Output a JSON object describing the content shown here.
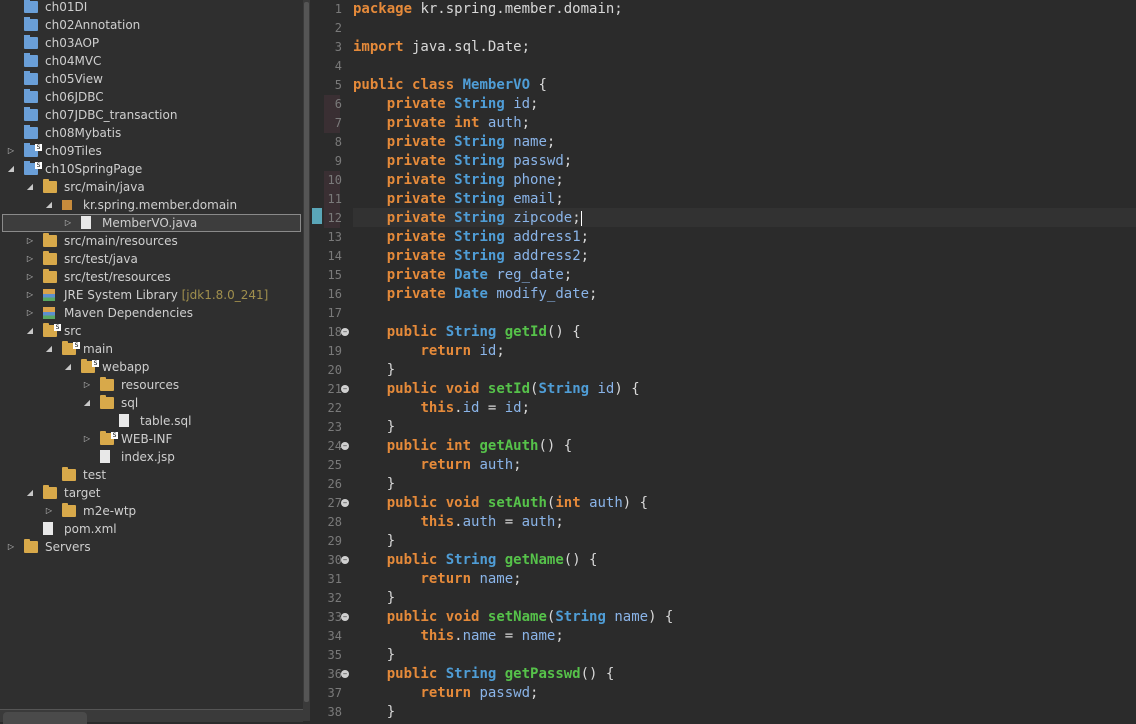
{
  "explorer": {
    "items": [
      {
        "label": "ch01DI",
        "indent": 0,
        "icon": "project-folder-icon",
        "arrow": ""
      },
      {
        "label": "ch02Annotation",
        "indent": 0,
        "icon": "project-folder-icon",
        "arrow": ""
      },
      {
        "label": "ch03AOP",
        "indent": 0,
        "icon": "project-folder-icon",
        "arrow": ""
      },
      {
        "label": "ch04MVC",
        "indent": 0,
        "icon": "project-folder-icon",
        "arrow": ""
      },
      {
        "label": "ch05View",
        "indent": 0,
        "icon": "project-folder-icon",
        "arrow": ""
      },
      {
        "label": "ch06JDBC",
        "indent": 0,
        "icon": "project-folder-icon",
        "arrow": ""
      },
      {
        "label": "ch07JDBC_transaction",
        "indent": 0,
        "icon": "project-folder-icon",
        "arrow": ""
      },
      {
        "label": "ch08Mybatis",
        "indent": 0,
        "icon": "project-folder-icon",
        "arrow": ""
      },
      {
        "label": "ch09Tiles",
        "indent": 0,
        "icon": "maven-project-icon",
        "arrow": "collapsed"
      },
      {
        "label": "ch10SpringPage",
        "indent": 0,
        "icon": "maven-project-icon",
        "arrow": "expanded"
      },
      {
        "label": "src/main/java",
        "indent": 1,
        "icon": "source-folder-icon",
        "arrow": "expanded"
      },
      {
        "label": "kr.spring.member.domain",
        "indent": 2,
        "icon": "package-icon",
        "arrow": "expanded"
      },
      {
        "label": "MemberVO.java",
        "indent": 3,
        "icon": "java-file-icon",
        "arrow": "collapsed",
        "selected": true
      },
      {
        "label": "src/main/resources",
        "indent": 1,
        "icon": "source-folder-icon",
        "arrow": "collapsed"
      },
      {
        "label": "src/test/java",
        "indent": 1,
        "icon": "source-folder-icon",
        "arrow": "collapsed"
      },
      {
        "label": "src/test/resources",
        "indent": 1,
        "icon": "source-folder-icon",
        "arrow": "collapsed"
      },
      {
        "label": "JRE System Library",
        "suffix": "[jdk1.8.0_241]",
        "indent": 1,
        "icon": "library-icon",
        "arrow": "collapsed"
      },
      {
        "label": "Maven Dependencies",
        "indent": 1,
        "icon": "library-icon",
        "arrow": "collapsed"
      },
      {
        "label": "src",
        "indent": 1,
        "icon": "folder-icon",
        "arrow": "expanded"
      },
      {
        "label": "main",
        "indent": 2,
        "icon": "folder-icon",
        "arrow": "expanded"
      },
      {
        "label": "webapp",
        "indent": 3,
        "icon": "folder-icon",
        "arrow": "expanded"
      },
      {
        "label": "resources",
        "indent": 4,
        "icon": "folder-icon",
        "arrow": "collapsed"
      },
      {
        "label": "sql",
        "indent": 4,
        "icon": "folder-icon",
        "arrow": "expanded"
      },
      {
        "label": "table.sql",
        "indent": 5,
        "icon": "sql-file-icon",
        "arrow": ""
      },
      {
        "label": "WEB-INF",
        "indent": 4,
        "icon": "folder-icon",
        "arrow": "collapsed"
      },
      {
        "label": "index.jsp",
        "indent": 4,
        "icon": "jsp-file-icon",
        "arrow": ""
      },
      {
        "label": "test",
        "indent": 2,
        "icon": "folder-icon",
        "arrow": ""
      },
      {
        "label": "target",
        "indent": 1,
        "icon": "folder-icon",
        "arrow": "expanded"
      },
      {
        "label": "m2e-wtp",
        "indent": 2,
        "icon": "folder-icon",
        "arrow": "collapsed"
      },
      {
        "label": "pom.xml",
        "indent": 1,
        "icon": "maven-pom-icon",
        "arrow": ""
      },
      {
        "label": "Servers",
        "indent": 0,
        "icon": "folder-icon",
        "arrow": "collapsed"
      }
    ]
  },
  "editor": {
    "lines": [
      [
        [
          "kw",
          "package"
        ],
        [
          "p",
          " kr.spring.member.domain;"
        ]
      ],
      [],
      [
        [
          "kw",
          "import"
        ],
        [
          "p",
          " java.sql.Date;"
        ]
      ],
      [],
      [
        [
          "kw",
          "public"
        ],
        [
          "p",
          " "
        ],
        [
          "kw",
          "class"
        ],
        [
          "p",
          " "
        ],
        [
          "ty",
          "MemberVO"
        ],
        [
          "p",
          " {"
        ]
      ],
      [
        [
          "p",
          "    "
        ],
        [
          "kw",
          "private"
        ],
        [
          "p",
          " "
        ],
        [
          "ty",
          "String"
        ],
        [
          "p",
          " "
        ],
        [
          "fd",
          "id"
        ],
        [
          "p",
          ";"
        ]
      ],
      [
        [
          "p",
          "    "
        ],
        [
          "kw",
          "private"
        ],
        [
          "p",
          " "
        ],
        [
          "kw",
          "int"
        ],
        [
          "p",
          " "
        ],
        [
          "fd",
          "auth"
        ],
        [
          "p",
          ";"
        ]
      ],
      [
        [
          "p",
          "    "
        ],
        [
          "kw",
          "private"
        ],
        [
          "p",
          " "
        ],
        [
          "ty",
          "String"
        ],
        [
          "p",
          " "
        ],
        [
          "fd",
          "name"
        ],
        [
          "p",
          ";"
        ]
      ],
      [
        [
          "p",
          "    "
        ],
        [
          "kw",
          "private"
        ],
        [
          "p",
          " "
        ],
        [
          "ty",
          "String"
        ],
        [
          "p",
          " "
        ],
        [
          "fd",
          "passwd"
        ],
        [
          "p",
          ";"
        ]
      ],
      [
        [
          "p",
          "    "
        ],
        [
          "kw",
          "private"
        ],
        [
          "p",
          " "
        ],
        [
          "ty",
          "String"
        ],
        [
          "p",
          " "
        ],
        [
          "fd",
          "phone"
        ],
        [
          "p",
          ";"
        ]
      ],
      [
        [
          "p",
          "    "
        ],
        [
          "kw",
          "private"
        ],
        [
          "p",
          " "
        ],
        [
          "ty",
          "String"
        ],
        [
          "p",
          " "
        ],
        [
          "fd",
          "email"
        ],
        [
          "p",
          ";"
        ]
      ],
      [
        [
          "p",
          "    "
        ],
        [
          "kw",
          "private"
        ],
        [
          "p",
          " "
        ],
        [
          "ty",
          "String"
        ],
        [
          "p",
          " "
        ],
        [
          "fd",
          "zipcode"
        ],
        [
          "p",
          ";"
        ],
        [
          "cursor",
          ""
        ]
      ],
      [
        [
          "p",
          "    "
        ],
        [
          "kw",
          "private"
        ],
        [
          "p",
          " "
        ],
        [
          "ty",
          "String"
        ],
        [
          "p",
          " "
        ],
        [
          "fd",
          "address1"
        ],
        [
          "p",
          ";"
        ]
      ],
      [
        [
          "p",
          "    "
        ],
        [
          "kw",
          "private"
        ],
        [
          "p",
          " "
        ],
        [
          "ty",
          "String"
        ],
        [
          "p",
          " "
        ],
        [
          "fd",
          "address2"
        ],
        [
          "p",
          ";"
        ]
      ],
      [
        [
          "p",
          "    "
        ],
        [
          "kw",
          "private"
        ],
        [
          "p",
          " "
        ],
        [
          "ty",
          "Date"
        ],
        [
          "p",
          " "
        ],
        [
          "fd",
          "reg_date"
        ],
        [
          "p",
          ";"
        ]
      ],
      [
        [
          "p",
          "    "
        ],
        [
          "kw",
          "private"
        ],
        [
          "p",
          " "
        ],
        [
          "ty",
          "Date"
        ],
        [
          "p",
          " "
        ],
        [
          "fd",
          "modify_date"
        ],
        [
          "p",
          ";"
        ]
      ],
      [],
      [
        [
          "p",
          "    "
        ],
        [
          "kw",
          "public"
        ],
        [
          "p",
          " "
        ],
        [
          "ty",
          "String"
        ],
        [
          "p",
          " "
        ],
        [
          "mt",
          "getId"
        ],
        [
          "p",
          "() {"
        ]
      ],
      [
        [
          "p",
          "        "
        ],
        [
          "kw",
          "return"
        ],
        [
          "p",
          " "
        ],
        [
          "fd",
          "id"
        ],
        [
          "p",
          ";"
        ]
      ],
      [
        [
          "p",
          "    }"
        ]
      ],
      [
        [
          "p",
          "    "
        ],
        [
          "kw",
          "public"
        ],
        [
          "p",
          " "
        ],
        [
          "kw",
          "void"
        ],
        [
          "p",
          " "
        ],
        [
          "mt",
          "setId"
        ],
        [
          "p",
          "("
        ],
        [
          "ty",
          "String"
        ],
        [
          "p",
          " "
        ],
        [
          "fd",
          "id"
        ],
        [
          "p",
          ") {"
        ]
      ],
      [
        [
          "p",
          "        "
        ],
        [
          "kw",
          "this"
        ],
        [
          "p",
          "."
        ],
        [
          "fd",
          "id"
        ],
        [
          "p",
          " = "
        ],
        [
          "fd",
          "id"
        ],
        [
          "p",
          ";"
        ]
      ],
      [
        [
          "p",
          "    }"
        ]
      ],
      [
        [
          "p",
          "    "
        ],
        [
          "kw",
          "public"
        ],
        [
          "p",
          " "
        ],
        [
          "kw",
          "int"
        ],
        [
          "p",
          " "
        ],
        [
          "mt",
          "getAuth"
        ],
        [
          "p",
          "() {"
        ]
      ],
      [
        [
          "p",
          "        "
        ],
        [
          "kw",
          "return"
        ],
        [
          "p",
          " "
        ],
        [
          "fd",
          "auth"
        ],
        [
          "p",
          ";"
        ]
      ],
      [
        [
          "p",
          "    }"
        ]
      ],
      [
        [
          "p",
          "    "
        ],
        [
          "kw",
          "public"
        ],
        [
          "p",
          " "
        ],
        [
          "kw",
          "void"
        ],
        [
          "p",
          " "
        ],
        [
          "mt",
          "setAuth"
        ],
        [
          "p",
          "("
        ],
        [
          "kw",
          "int"
        ],
        [
          "p",
          " "
        ],
        [
          "fd",
          "auth"
        ],
        [
          "p",
          ") {"
        ]
      ],
      [
        [
          "p",
          "        "
        ],
        [
          "kw",
          "this"
        ],
        [
          "p",
          "."
        ],
        [
          "fd",
          "auth"
        ],
        [
          "p",
          " = "
        ],
        [
          "fd",
          "auth"
        ],
        [
          "p",
          ";"
        ]
      ],
      [
        [
          "p",
          "    }"
        ]
      ],
      [
        [
          "p",
          "    "
        ],
        [
          "kw",
          "public"
        ],
        [
          "p",
          " "
        ],
        [
          "ty",
          "String"
        ],
        [
          "p",
          " "
        ],
        [
          "mt",
          "getName"
        ],
        [
          "p",
          "() {"
        ]
      ],
      [
        [
          "p",
          "        "
        ],
        [
          "kw",
          "return"
        ],
        [
          "p",
          " "
        ],
        [
          "fd",
          "name"
        ],
        [
          "p",
          ";"
        ]
      ],
      [
        [
          "p",
          "    }"
        ]
      ],
      [
        [
          "p",
          "    "
        ],
        [
          "kw",
          "public"
        ],
        [
          "p",
          " "
        ],
        [
          "kw",
          "void"
        ],
        [
          "p",
          " "
        ],
        [
          "mt",
          "setName"
        ],
        [
          "p",
          "("
        ],
        [
          "ty",
          "String"
        ],
        [
          "p",
          " "
        ],
        [
          "fd",
          "name"
        ],
        [
          "p",
          ") {"
        ]
      ],
      [
        [
          "p",
          "        "
        ],
        [
          "kw",
          "this"
        ],
        [
          "p",
          "."
        ],
        [
          "fd",
          "name"
        ],
        [
          "p",
          " = "
        ],
        [
          "fd",
          "name"
        ],
        [
          "p",
          ";"
        ]
      ],
      [
        [
          "p",
          "    }"
        ]
      ],
      [
        [
          "p",
          "    "
        ],
        [
          "kw",
          "public"
        ],
        [
          "p",
          " "
        ],
        [
          "ty",
          "String"
        ],
        [
          "p",
          " "
        ],
        [
          "mt",
          "getPasswd"
        ],
        [
          "p",
          "() {"
        ]
      ],
      [
        [
          "p",
          "        "
        ],
        [
          "kw",
          "return"
        ],
        [
          "p",
          " "
        ],
        [
          "fd",
          "passwd"
        ],
        [
          "p",
          ";"
        ]
      ],
      [
        [
          "p",
          "    }"
        ]
      ]
    ],
    "fold_lines": [
      18,
      21,
      24,
      27,
      30,
      33,
      36
    ],
    "current_line": 12
  },
  "colors": {
    "keyword": "#e58a3a",
    "type": "#4f9dd6",
    "method": "#56c24a",
    "field": "#8ab4e8",
    "text": "#d8d8d8",
    "background": "#2b2b2b"
  }
}
